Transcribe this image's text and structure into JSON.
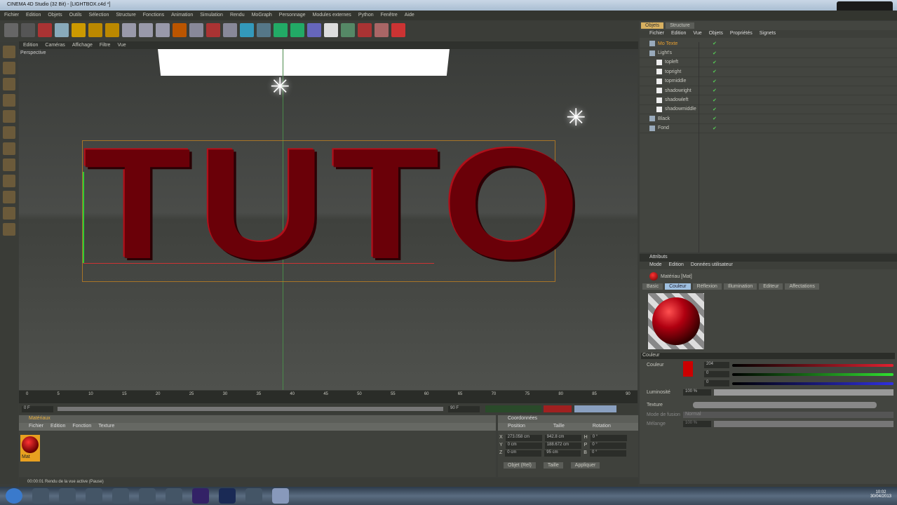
{
  "window": {
    "title": "CINEMA 4D Studio (32 Bit) - [LIGHTBOX.c4d *]"
  },
  "menu": [
    "Fichier",
    "Edition",
    "Objets",
    "Outils",
    "Sélection",
    "Structure",
    "Fonctions",
    "Animation",
    "Simulation",
    "Rendu",
    "MoGraph",
    "Personnage",
    "Modules externes",
    "Python",
    "Fenêtre",
    "Aide"
  ],
  "viewport": {
    "menu": [
      "Edition",
      "Caméras",
      "Affichage",
      "Filtre",
      "Vue"
    ],
    "label": "Perspective",
    "text": "TUTO"
  },
  "timeline": {
    "ticks": [
      "0",
      "5",
      "10",
      "15",
      "20",
      "25",
      "30",
      "35",
      "40",
      "45",
      "50",
      "55",
      "60",
      "65",
      "70",
      "75",
      "80",
      "85",
      "90"
    ],
    "end": "0 F",
    "start_field": "0 F",
    "end_field": "90 F"
  },
  "materials": {
    "title": "Matériaux",
    "menu": [
      "Fichier",
      "Edition",
      "Fonction",
      "Texture"
    ],
    "item": "Mat"
  },
  "coords": {
    "title": "Coordonnées",
    "cols": [
      "Position",
      "Taille",
      "Rotation"
    ],
    "rows": [
      {
        "axis": "X",
        "pos": "273.058 cm",
        "size": "942.8 cm",
        "rl": "H",
        "rot": "0 °"
      },
      {
        "axis": "Y",
        "pos": "0 cm",
        "size": "188.672 cm",
        "rl": "P",
        "rot": "0 °"
      },
      {
        "axis": "Z",
        "pos": "0 cm",
        "size": "95 cm",
        "rl": "B",
        "rot": "0 °"
      }
    ],
    "mode": "Objet (Rel)",
    "size_mode": "Taille",
    "apply": "Appliquer"
  },
  "status": "00:00:01  Rendu de la vue active (Pause)",
  "objects": {
    "tabs": [
      "Objets",
      "Structure"
    ],
    "menu": [
      "Fichier",
      "Edition",
      "Vue",
      "Objets",
      "Propriétés",
      "Signets"
    ],
    "items": [
      {
        "name": "Mo Texte",
        "level": 0
      },
      {
        "name": "Light's",
        "level": 0
      },
      {
        "name": "topleft",
        "level": 1
      },
      {
        "name": "topright",
        "level": 1
      },
      {
        "name": "topmiddle",
        "level": 1
      },
      {
        "name": "shadowright",
        "level": 1
      },
      {
        "name": "shadowleft",
        "level": 1
      },
      {
        "name": "shadowmiddle",
        "level": 1
      },
      {
        "name": "Black",
        "level": 0
      },
      {
        "name": "Fond",
        "level": 0
      }
    ]
  },
  "attributes": {
    "title": "Attributs",
    "menu": [
      "Mode",
      "Edition",
      "Données utilisateur"
    ],
    "material": "Matériau [Mat]",
    "tabs": [
      "Basic",
      "Couleur",
      "Réflexion",
      "Illumination",
      "Editeur",
      "Affectations"
    ],
    "active_tab": "Couleur",
    "section": "Couleur",
    "color_label": "Couleur",
    "r": "204",
    "g": "0",
    "b": "0",
    "r_fraction": 0.8,
    "brightness_label": "Luminosité",
    "brightness": "100 %",
    "texture_label": "Texture",
    "blend_label": "Mode de fusion",
    "blend": "Normal",
    "mix_label": "Mélange",
    "mix": "100 %"
  },
  "taskbar": {
    "time": "10:02",
    "date": "30/04/2013"
  }
}
